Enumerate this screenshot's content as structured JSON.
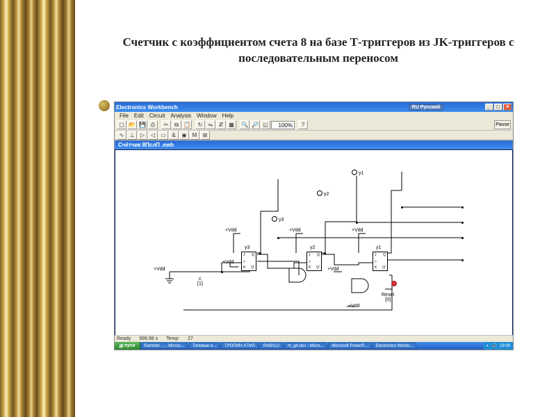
{
  "slide": {
    "title": "Счетчик с коэффициентом счета 8 на базе Т-триггеров из JK-триггеров с последовательным переносом"
  },
  "window": {
    "app_title": "Electronics Workbench",
    "language": "RU Русский",
    "min": "_",
    "max": "□",
    "close": "×"
  },
  "menu": {
    "file": "File",
    "edit": "Edit",
    "circuit": "Circuit",
    "analysis": "Analysis",
    "window": "Window",
    "help": "Help"
  },
  "toolbar": {
    "zoom": "100%",
    "pause": "Pause"
  },
  "doc": {
    "title": "Cчётчик 8ПслП .ewb"
  },
  "labels": {
    "c": "c\n[1]",
    "reset": "Reset\n[0]",
    "vdd": "+Vdd",
    "y1": "y1",
    "y2": "y2",
    "y3": "y3",
    "y1b": "y1",
    "y2b": "y2",
    "y3b": "y3"
  },
  "jk": {
    "j": "J",
    "q": "Q",
    "k": "K",
    "qn": "Q'",
    "clk": ">"
  },
  "status": {
    "ready": "Ready",
    "time_lbl": "",
    "time": "999.98 s",
    "temp_lbl": "Temp:",
    "temp": "27"
  },
  "taskbar": {
    "start": "пуск",
    "items": [
      "Rambler ... - Micros...",
      "Типовые и...",
      "TPOПИН-ХТМЛ",
      "RABS12",
      "m_g4.doc - Micro...",
      "Microsoft PowerP...",
      "Electronics Workb..."
    ],
    "clock": "19:06"
  }
}
